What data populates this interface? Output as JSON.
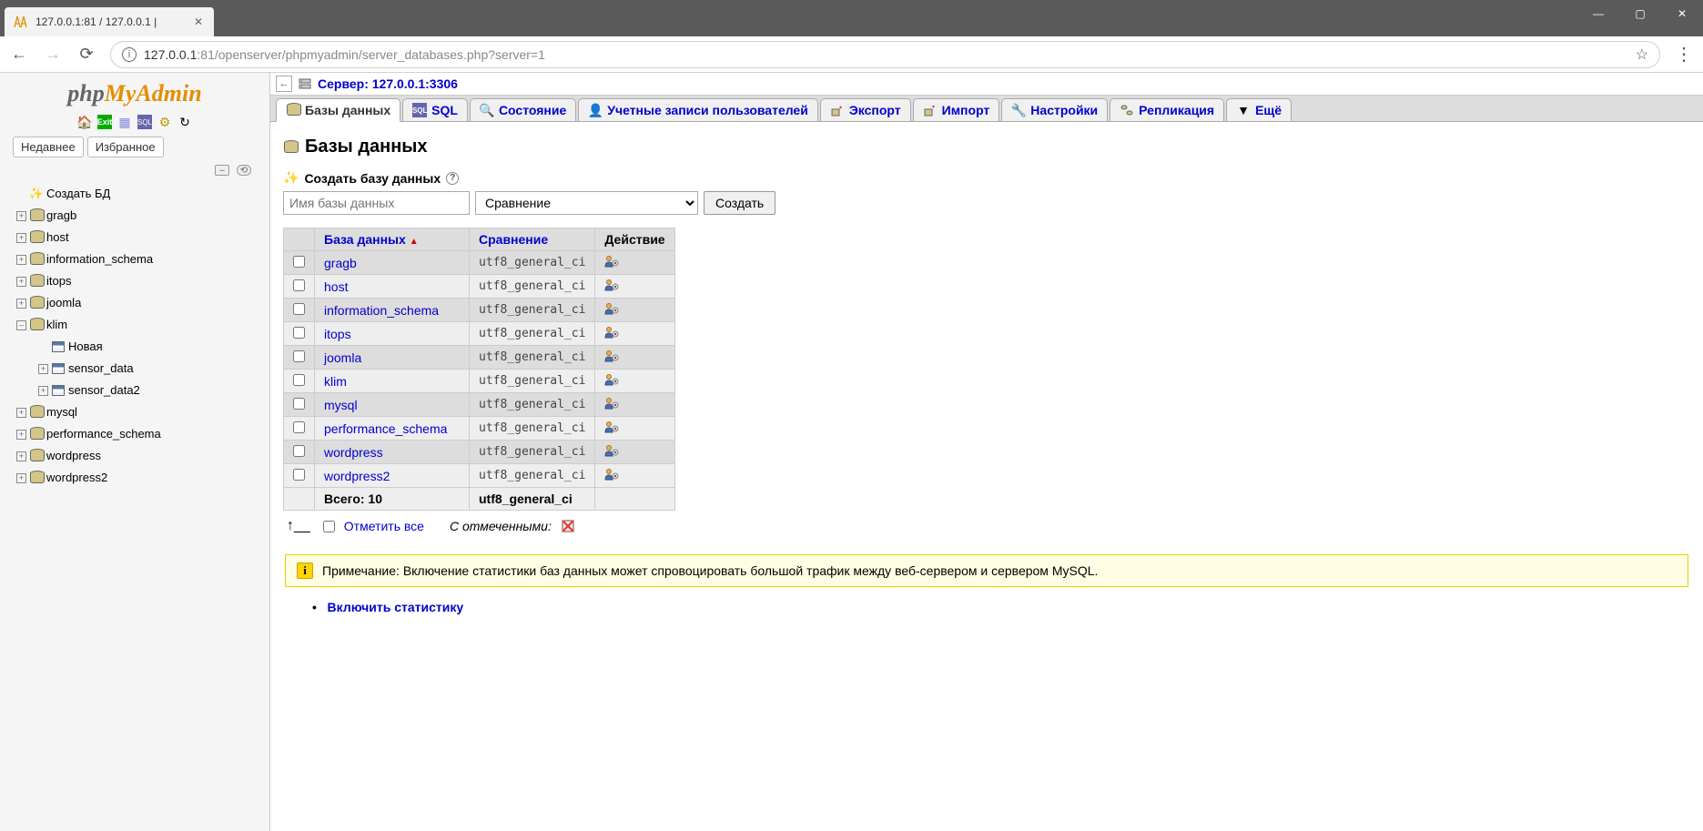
{
  "browser": {
    "tab_title": "127.0.0.1:81 / 127.0.0.1 | ",
    "url_host": "127.0.0.1",
    "url_rest": ":81/openserver/phpmyadmin/server_databases.php?server=1"
  },
  "sidebar": {
    "logo_php": "php",
    "logo_myadmin": "MyAdmin",
    "tab_recent": "Недавнее",
    "tab_fav": "Избранное",
    "new_db": "Создать БД",
    "tree": [
      "gragb",
      "host",
      "information_schema",
      "itops",
      "joomla",
      "klim",
      "mysql",
      "performance_schema",
      "wordpress",
      "wordpress2"
    ],
    "klim_children": {
      "new": "Новая",
      "t1": "sensor_data",
      "t2": "sensor_data2"
    }
  },
  "server_line": "Сервер: 127.0.0.1:3306",
  "tabs": {
    "db": "Базы данных",
    "sql": "SQL",
    "status": "Состояние",
    "users": "Учетные записи пользователей",
    "export": "Экспорт",
    "import": "Импорт",
    "settings": "Настройки",
    "replication": "Репликация",
    "more": "Ещё"
  },
  "page": {
    "title": "Базы данных",
    "create_h": "Создать базу данных",
    "name_ph": "Имя базы данных",
    "collation_ph": "Сравнение",
    "create_btn": "Создать"
  },
  "table": {
    "col_db": "База данных",
    "col_coll": "Сравнение",
    "col_action": "Действие",
    "rows": [
      {
        "name": "gragb",
        "coll": "utf8_general_ci"
      },
      {
        "name": "host",
        "coll": "utf8_general_ci"
      },
      {
        "name": "information_schema",
        "coll": "utf8_general_ci"
      },
      {
        "name": "itops",
        "coll": "utf8_general_ci"
      },
      {
        "name": "joomla",
        "coll": "utf8_general_ci"
      },
      {
        "name": "klim",
        "coll": "utf8_general_ci"
      },
      {
        "name": "mysql",
        "coll": "utf8_general_ci"
      },
      {
        "name": "performance_schema",
        "coll": "utf8_general_ci"
      },
      {
        "name": "wordpress",
        "coll": "utf8_general_ci"
      },
      {
        "name": "wordpress2",
        "coll": "utf8_general_ci"
      }
    ],
    "total_label": "Всего: 10",
    "total_coll": "utf8_general_ci"
  },
  "checkall": {
    "label": "Отметить все",
    "with": "С отмеченными:"
  },
  "notice": "Примечание: Включение статистики баз данных может спровоцировать большой трафик между веб-сервером и сервером MySQL.",
  "enable_stats": "Включить статистику"
}
